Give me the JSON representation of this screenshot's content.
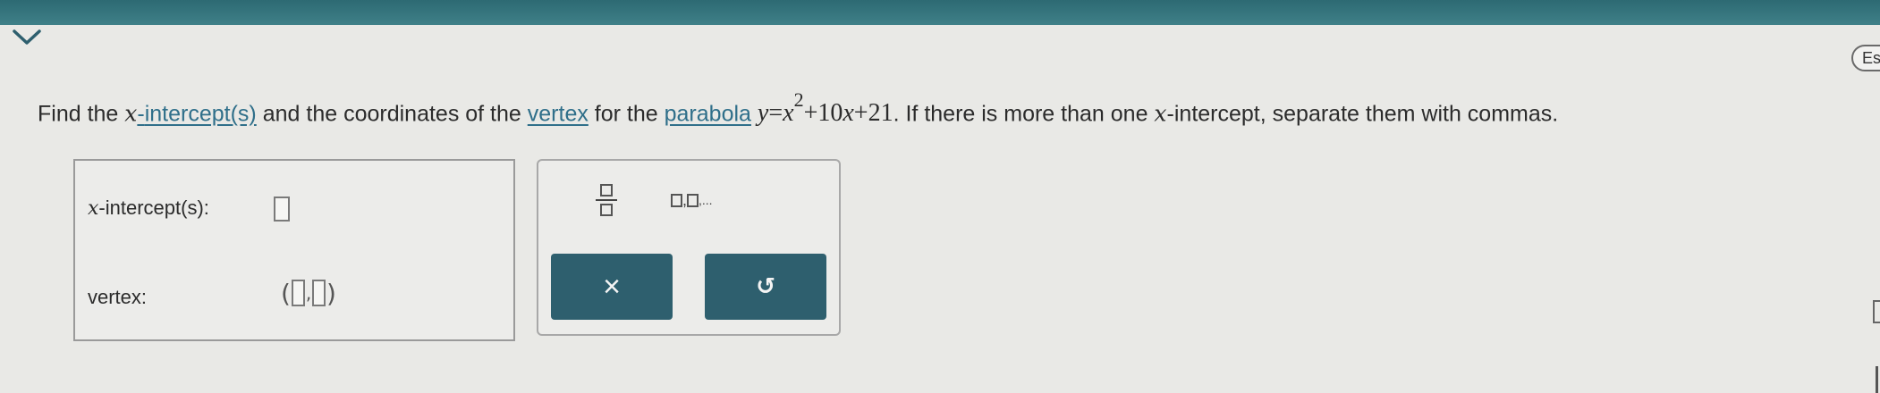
{
  "header": {
    "lang_button_label": "Esp"
  },
  "question": {
    "part1": "Find the ",
    "var_x1": "x",
    "dash": "-",
    "intercepts_link": "intercept(s)",
    "part2": " and the coordinates of the ",
    "vertex_link": "vertex",
    "part3": " for the ",
    "parabola_link": "parabola",
    "eq_lhs": "y",
    "eq_equals": "=",
    "eq_x": "x",
    "eq_exp": "2",
    "eq_plus1": "+10",
    "eq_x2": "x",
    "eq_plus2": "+21",
    "part4": ". If there is more than one ",
    "var_x2": "x",
    "part5": "-intercept, separate them with commas."
  },
  "answers": {
    "x_intercepts_var": "x",
    "x_intercepts_label": "-intercept(s):",
    "x_intercepts_value": "",
    "vertex_label": "vertex:",
    "vertex_open": "(",
    "vertex_comma": ",",
    "vertex_close": ")"
  },
  "tools": {
    "list_separator": ",",
    "list_ellipsis": ",...",
    "clear_symbol": "×",
    "undo_symbol": "↺"
  },
  "colors": {
    "top_bar": "#3a7b84",
    "link": "#2f6f8a",
    "action_button": "#2e5f6e"
  }
}
